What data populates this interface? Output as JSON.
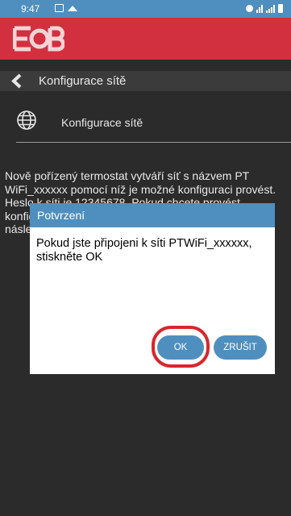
{
  "status_bar": {
    "time": "9:47"
  },
  "app": {
    "logo_text": "EOB"
  },
  "nav": {
    "title": "Konfigurace sítě"
  },
  "settings_row": {
    "label": "Konfigurace sítě"
  },
  "info_text": "Nově pořízený termostat vytváří síť s názvem PT WiFi_xxxxxx pomocí níž je možné konfiguraci provést. Heslo k síti je 12345678. Pokud chcete provést konfiguraci pomocí  WiFi stiskněte tl. POMOCÍ WiFi a následně se k této síti připojte.",
  "dialog": {
    "title": "Potvrzení",
    "message": "Pokud jste připojeni k síti PTWiFi_xxxxxx, stiskněte OK",
    "ok_label": "OK",
    "cancel_label": "ZRUŠIT"
  },
  "colors": {
    "accent": "#4f8fbf",
    "brand": "#d2303f",
    "highlight": "#d7262e",
    "background": "#2b2b2b"
  }
}
